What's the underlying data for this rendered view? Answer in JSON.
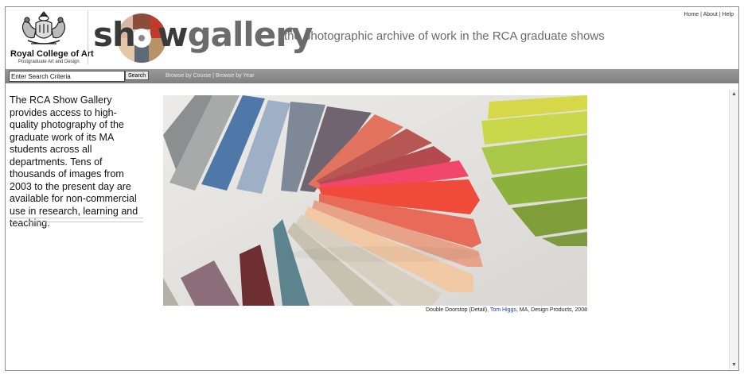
{
  "header": {
    "institution_name": "Royal College of Art",
    "institution_subtitle": "Postgraduate Art and Design",
    "logo_show": "sh",
    "logo_o": "o",
    "logo_w": "w",
    "logo_gallery": "gallery",
    "tagline": "the photographic archive of work in the RCA graduate shows",
    "toplinks": {
      "home": "Home",
      "about": "About",
      "help": "Help",
      "separator": "|"
    }
  },
  "search": {
    "placeholder": "Enter Search Criteria",
    "value": "Enter Search Criteria",
    "button_label": "Search",
    "browse_by_course": "Browse by Course",
    "browse_separator": "|",
    "browse_by_year": "Browse by Year"
  },
  "intro": {
    "text": "The RCA Show Gallery provides access to high-quality photography of the graduate work of its MA students across all departments. Tens of thousands of images from 2003 to the present day are available for non-commercial use in research, learning and teaching."
  },
  "featured": {
    "title": "Double Doorstop (Detail),",
    "artist": "Tom Higgs",
    "details": ", MA, Design Products, 2008"
  },
  "icons": {
    "crest": "royal-crest-icon",
    "scroll_up": "scroll-up-arrow-icon",
    "scroll_down": "scroll-down-arrow-icon"
  },
  "colors": {
    "search_bar": "#8a8a8a",
    "artist_link": "#1e3fa8",
    "tagline": "#6a6a6a"
  }
}
